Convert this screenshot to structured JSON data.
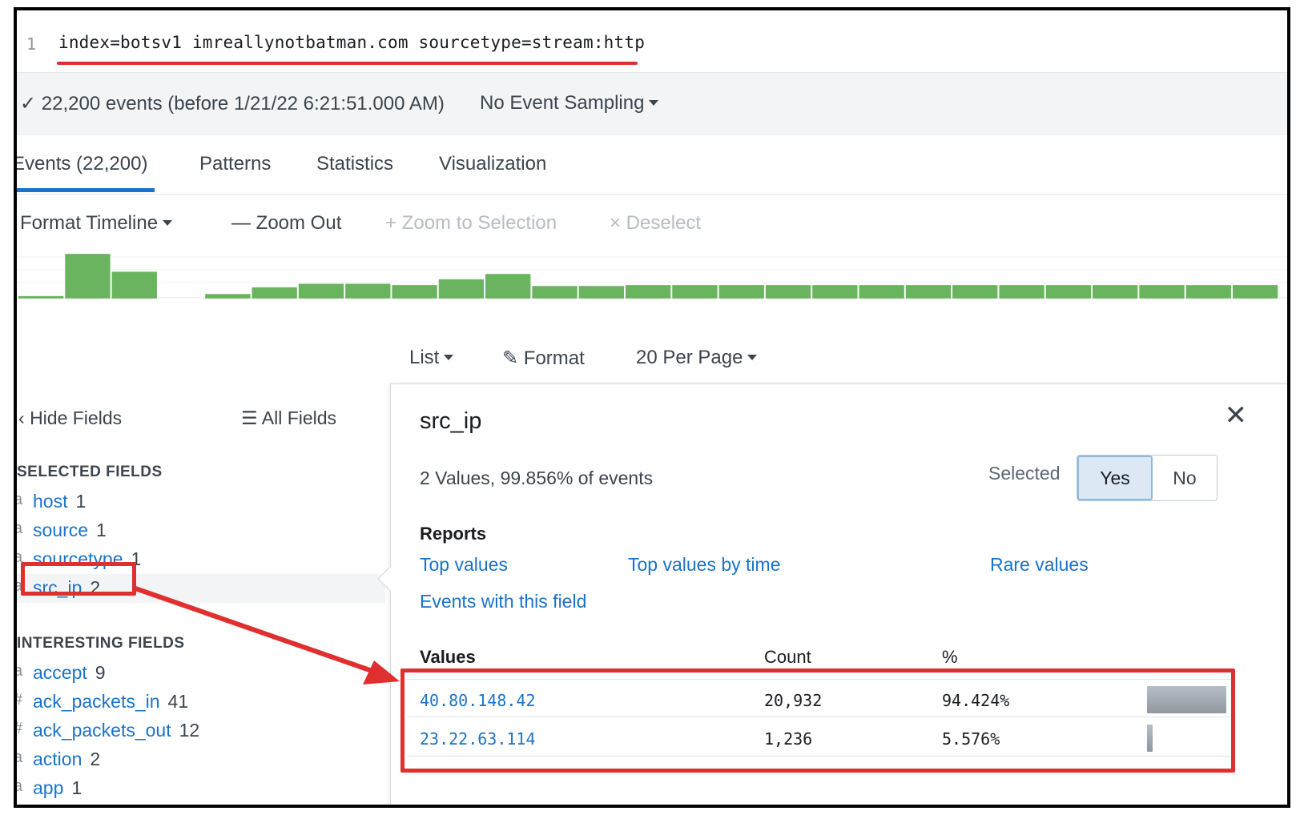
{
  "search": {
    "line_number": "1",
    "query": "index=botsv1 imreallynotbatman.com sourcetype=stream:http"
  },
  "status": {
    "events_text": "✓ 22,200 events (before 1/21/22 6:21:51.000 AM)",
    "sampling": "No Event Sampling"
  },
  "tabs": [
    {
      "label": "Events (22,200)",
      "active": true
    },
    {
      "label": "Patterns",
      "active": false
    },
    {
      "label": "Statistics",
      "active": false
    },
    {
      "label": "Visualization",
      "active": false
    }
  ],
  "timeline": {
    "format": "Format Timeline",
    "zoom_out": "— Zoom Out",
    "zoom_selection": "+ Zoom to Selection",
    "deselect": "× Deselect",
    "bar_levels": [
      0.05,
      1.0,
      0.6,
      0,
      0.1,
      0.25,
      0.33,
      0.33,
      0.3,
      0.43,
      0.55,
      0.28,
      0.28,
      0.3,
      0.3,
      0.3,
      0.3,
      0.3,
      0.3,
      0.3,
      0.3,
      0.3,
      0.3,
      0.3,
      0.3,
      0.3,
      0.3
    ],
    "bar_color": "#6ab35f"
  },
  "results_controls": {
    "list": "List",
    "format": "Format",
    "per_page": "20 Per Page"
  },
  "fields": {
    "hide_fields": "Hide Fields",
    "all_fields": "All Fields",
    "selected_heading": "SELECTED FIELDS",
    "selected": [
      {
        "prefix": "a",
        "name": "host",
        "count": "1"
      },
      {
        "prefix": "a",
        "name": "source",
        "count": "1"
      },
      {
        "prefix": "a",
        "name": "sourcetype",
        "count": "1"
      },
      {
        "prefix": "a",
        "name": "src_ip",
        "count": "2"
      }
    ],
    "interesting_heading": "INTERESTING FIELDS",
    "interesting": [
      {
        "prefix": "a",
        "name": "accept",
        "count": "9"
      },
      {
        "prefix": "#",
        "name": "ack_packets_in",
        "count": "41"
      },
      {
        "prefix": "#",
        "name": "ack_packets_out",
        "count": "12"
      },
      {
        "prefix": "a",
        "name": "action",
        "count": "2"
      },
      {
        "prefix": "a",
        "name": "app",
        "count": "1"
      }
    ]
  },
  "popover": {
    "title": "src_ip",
    "close": "✕",
    "summary": "2 Values, 99.856% of events",
    "selected_label": "Selected",
    "yes": "Yes",
    "no": "No",
    "reports_heading": "Reports",
    "reports": [
      "Top values",
      "Top values by time",
      "Rare values",
      "Events with this field"
    ],
    "columns": [
      "Values",
      "Count",
      "%"
    ],
    "rows": [
      {
        "value": "40.80.148.42",
        "count": "20,932",
        "percent": "94.424%",
        "fraction": 0.94424
      },
      {
        "value": "23.22.63.114",
        "count": "1,236",
        "percent": "5.576%",
        "fraction": 0.05576
      }
    ]
  },
  "colors": {
    "link": "#1a73c8",
    "annotation": "#e02f2f",
    "tab_indicator": "#1a73c8"
  }
}
